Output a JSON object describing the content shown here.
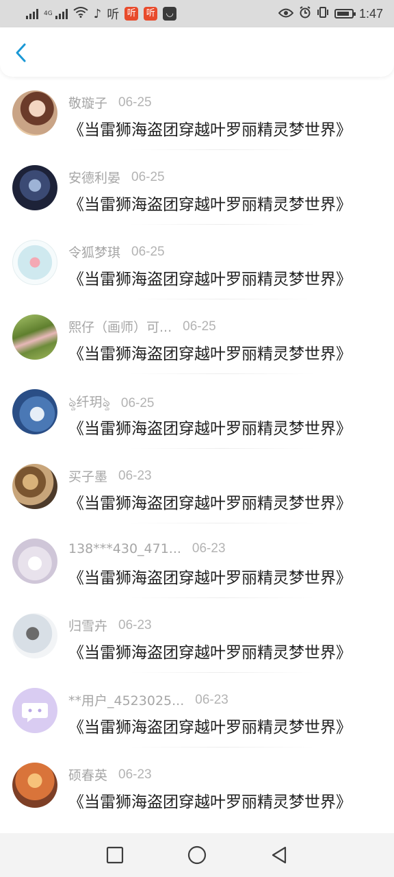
{
  "status_bar": {
    "network_type": "4G",
    "app_icons": [
      "听",
      "听",
      "听"
    ],
    "time": "1:47"
  },
  "header": {
    "back_icon": "chevron-left-icon",
    "accent_color": "#1a98d5"
  },
  "items": [
    {
      "name": "敬璇子",
      "date": "06-25",
      "title": "《当雷狮海盗团穿越叶罗丽精灵梦世界》"
    },
    {
      "name": "安德利晏",
      "date": "06-25",
      "title": "《当雷狮海盗团穿越叶罗丽精灵梦世界》"
    },
    {
      "name": "令狐梦琪",
      "date": "06-25",
      "title": "《当雷狮海盗团穿越叶罗丽精灵梦世界》"
    },
    {
      "name": "熙仔（画师）可...",
      "date": "06-25",
      "title": "《当雷狮海盗团穿越叶罗丽精灵梦世界》"
    },
    {
      "name": "ৡ纤玥ৡ",
      "date": "06-25",
      "title": "《当雷狮海盗团穿越叶罗丽精灵梦世界》"
    },
    {
      "name": "买子墨",
      "date": "06-23",
      "title": "《当雷狮海盗团穿越叶罗丽精灵梦世界》"
    },
    {
      "name": "138***430_471...",
      "date": "06-23",
      "title": "《当雷狮海盗团穿越叶罗丽精灵梦世界》"
    },
    {
      "name": "归雪卉",
      "date": "06-23",
      "title": "《当雷狮海盗团穿越叶罗丽精灵梦世界》"
    },
    {
      "name": "**用户_4523025...",
      "date": "06-23",
      "title": "《当雷狮海盗团穿越叶罗丽精灵梦世界》"
    },
    {
      "name": "硕春英",
      "date": "06-23",
      "title": "《当雷狮海盗团穿越叶罗丽精灵梦世界》"
    }
  ],
  "nav_bar": {
    "icons": [
      "recents-square-icon",
      "home-circle-icon",
      "back-triangle-icon"
    ]
  }
}
